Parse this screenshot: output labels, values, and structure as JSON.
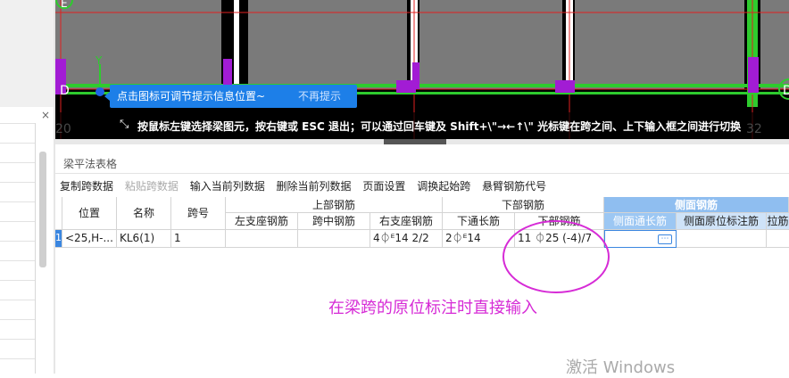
{
  "left_panel": {
    "close_label": "×"
  },
  "cad": {
    "axis_labels": {
      "d_left": "D",
      "d_right": "D",
      "e_top": "E",
      "n_20": "20",
      "n_32": "32",
      "y_axis": "Y"
    },
    "hint": {
      "text": "点击图标可调节提示信息位置~",
      "dismiss": "不再提示"
    },
    "status": "按鼠标左键选择梁图元，按右键或 ESC 退出；可以通过回车键及 Shift+\\\"→←↑\\\" 光标键在跨之间、上下输入框之间进行切换",
    "colors": {
      "beam": "#7a7a7a",
      "green": "#2ecb2e",
      "purple": "#a21cd4",
      "red": "#e02020"
    }
  },
  "grid": {
    "title": "梁平法表格",
    "toolbar": [
      "复制跨数据",
      "粘贴跨数据",
      "输入当前列数据",
      "删除当前列数据",
      "页面设置",
      "调换起始跨",
      "悬臂钢筋代号"
    ],
    "headers": {
      "position": "位置",
      "name": "名称",
      "span": "跨号",
      "top_group": "上部钢筋",
      "left_support": "左支座钢筋",
      "mid_span": "跨中钢筋",
      "right_support": "右支座钢筋",
      "bottom_group": "下部钢筋",
      "bottom_through": "下通长筋",
      "bottom_bar": "下部钢筋",
      "side_group": "侧面钢筋",
      "side_through": "侧面通长筋",
      "side_in_situ": "侧面原位标注筋",
      "tie": "拉筋"
    },
    "row": {
      "marker": "1",
      "position": "<25,H-...",
      "name": "KL6(1)",
      "span": "1",
      "left_support": "",
      "mid_span": "",
      "right_support": "4⏀ᴱ14 2/2",
      "bottom_through": "2⏀ᴱ14",
      "bottom_bar": "11 ⏀25 (-4)/7",
      "side_through": "",
      "side_in_situ": "",
      "tie": ""
    },
    "ellipsis": "⋯"
  },
  "annotation": "在梁跨的原位标注时直接输入",
  "watermark": "激活 Windows"
}
